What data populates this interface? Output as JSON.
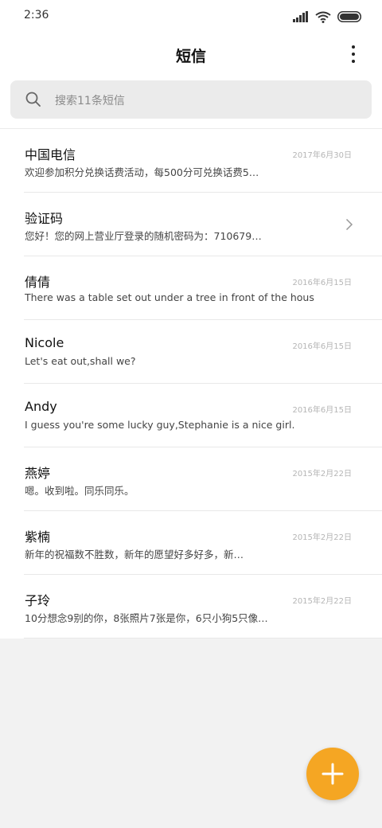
{
  "status_bar": {
    "time": "2:36"
  },
  "header": {
    "title": "短信"
  },
  "search": {
    "placeholder": "搜索11条短信"
  },
  "messages": [
    {
      "name": "中国电信",
      "date": "2017年6月30日",
      "preview": "欢迎参加积分兑换话费活动，每500分可兑换话费5…",
      "has_chevron": false
    },
    {
      "name": "验证码",
      "date": "",
      "preview": "您好！您的网上营业厅登录的随机密码为：710679…",
      "has_chevron": true
    },
    {
      "name": "倩倩",
      "date": "2016年6月15日",
      "preview": "There was a table set out under a tree in front of the hous",
      "has_chevron": false
    },
    {
      "name": "Nicole",
      "date": "2016年6月15日",
      "preview": "Let's eat out,shall we?",
      "has_chevron": false
    },
    {
      "name": "Andy",
      "date": "2016年6月15日",
      "preview": "I guess you're some lucky guy,Stephanie is a nice girl.",
      "has_chevron": false
    },
    {
      "name": "燕婷",
      "date": "2015年2月22日",
      "preview": "嗯。收到啦。同乐同乐。",
      "has_chevron": false
    },
    {
      "name": "紫楠",
      "date": "2015年2月22日",
      "preview": "新年的祝福数不胜数，新年的愿望好多好多，新…",
      "has_chevron": false
    },
    {
      "name": "子玲",
      "date": "2015年2月22日",
      "preview": "10分想念9别的你，8张照片7张是你，6只小狗5只像…",
      "has_chevron": false
    }
  ],
  "fab": {
    "icon": "plus-icon"
  },
  "colors": {
    "accent": "#f5a623",
    "background": "#f2f2f2",
    "search_bg": "#ebebeb"
  }
}
